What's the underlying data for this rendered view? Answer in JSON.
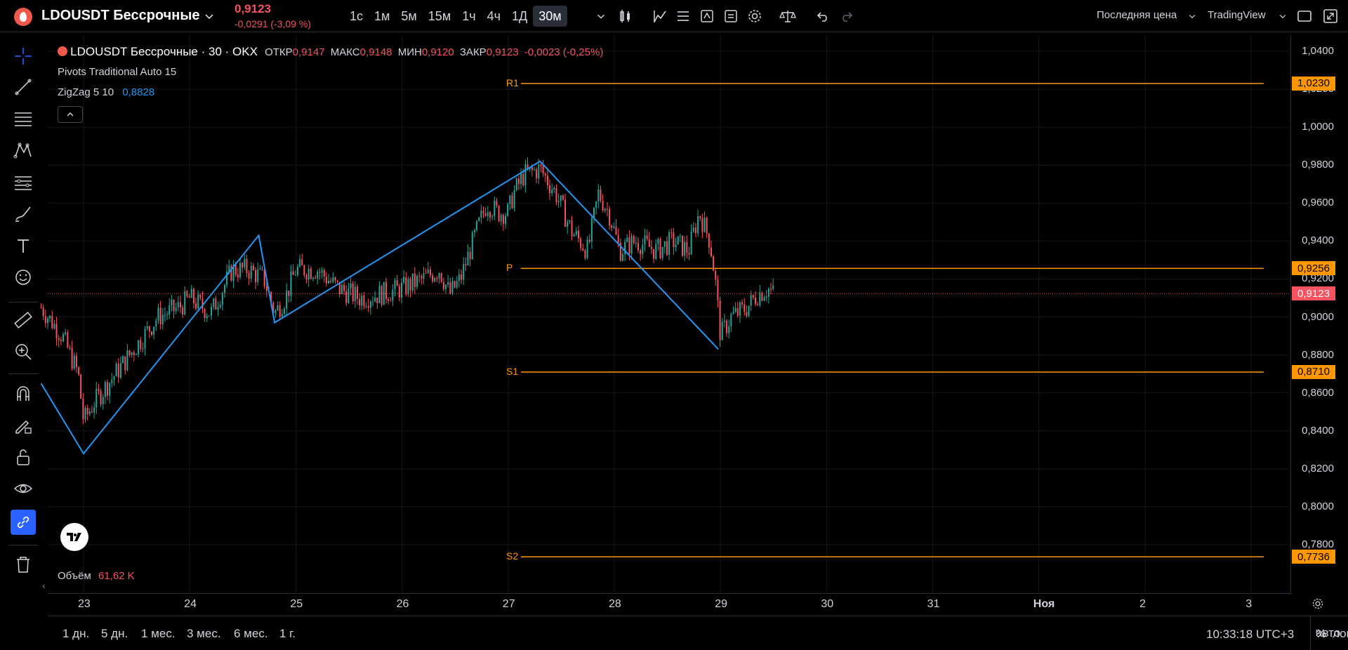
{
  "header": {
    "symbol_title": "LDOUSDT Бессрочные",
    "price": "0,9123",
    "change": "-0,0291 (-3,09 %)",
    "timeframes": [
      "1с",
      "1м",
      "5м",
      "15м",
      "1ч",
      "4ч",
      "1Д",
      "30м"
    ],
    "active_timeframe": "30м",
    "price_type": "Последняя цена",
    "layout_name": "TradingView"
  },
  "legend": {
    "symbol_line": "LDOUSDT Бессрочные · 30 · OKX",
    "open_label": "ОТКР",
    "open_value": "0,9147",
    "high_label": "МАКС",
    "high_value": "0,9148",
    "low_label": "МИН",
    "low_value": "0,9120",
    "close_label": "ЗАКР",
    "close_value": "0,9123",
    "change_value": "-0,0023 (-0,25%)",
    "indicator1": "Pivots Traditional Auto 15",
    "indicator2_name": "ZigZag 5 10",
    "indicator2_value": "0,8828",
    "volume_label": "Объём",
    "volume_value": "61,62 K"
  },
  "pivots": {
    "R1": {
      "label": "R1",
      "value": "1,0230",
      "price": 1.023
    },
    "P": {
      "label": "P",
      "value": "0,9256",
      "price": 0.9256
    },
    "S1": {
      "label": "S1",
      "value": "0,8710",
      "price": 0.871
    },
    "S2": {
      "label": "S2",
      "value": "0,7736",
      "price": 0.7736
    }
  },
  "current_price_tag": "0,9123",
  "price_axis_labels": [
    "1,0400",
    "1,0200",
    "1,0000",
    "0,9800",
    "0,9600",
    "0,9400",
    "0,9200",
    "0,9000",
    "0,8800",
    "0,8600",
    "0,8400",
    "0,8200",
    "0,8000",
    "0,7800"
  ],
  "time_axis_labels": [
    "23",
    "24",
    "25",
    "26",
    "27",
    "28",
    "29",
    "30",
    "31",
    "Ноя",
    "2",
    "3"
  ],
  "ranges": [
    "1 дн.",
    "5 дн.",
    "1 мес.",
    "3 мес.",
    "6 мес.",
    "1 г."
  ],
  "clock": "10:33:18 UTC+3",
  "bottom_right": {
    "percent": "%",
    "log": "лог",
    "auto": "авто"
  },
  "colors": {
    "up": "#26a69a",
    "down": "#f7525f",
    "zigzag": "#2196f3",
    "pivot": "#ff9800"
  },
  "chart_data": {
    "type": "candlestick",
    "title": "LDOUSDT Бессрочные · 30 · OKX",
    "ylim": [
      0.77,
      1.045
    ],
    "zigzag": [
      {
        "x": 22.6,
        "y": 0.865
      },
      {
        "x": 23.0,
        "y": 0.828
      },
      {
        "x": 24.65,
        "y": 0.943
      },
      {
        "x": 24.8,
        "y": 0.897
      },
      {
        "x": 27.3,
        "y": 0.982
      },
      {
        "x": 28.98,
        "y": 0.883
      }
    ],
    "price_path": [
      [
        22.6,
        0.905
      ],
      [
        22.8,
        0.89
      ],
      [
        22.95,
        0.87
      ],
      [
        23.0,
        0.845
      ],
      [
        23.1,
        0.855
      ],
      [
        23.3,
        0.87
      ],
      [
        23.5,
        0.885
      ],
      [
        23.7,
        0.9
      ],
      [
        23.9,
        0.905
      ],
      [
        24.0,
        0.91
      ],
      [
        24.2,
        0.902
      ],
      [
        24.4,
        0.925
      ],
      [
        24.55,
        0.925
      ],
      [
        24.7,
        0.92
      ],
      [
        24.8,
        0.902
      ],
      [
        24.9,
        0.91
      ],
      [
        25.0,
        0.925
      ],
      [
        25.2,
        0.925
      ],
      [
        25.4,
        0.915
      ],
      [
        25.6,
        0.91
      ],
      [
        25.8,
        0.912
      ],
      [
        26.0,
        0.915
      ],
      [
        26.2,
        0.92
      ],
      [
        26.35,
        0.925
      ],
      [
        26.45,
        0.912
      ],
      [
        26.55,
        0.92
      ],
      [
        26.7,
        0.945
      ],
      [
        26.8,
        0.96
      ],
      [
        26.9,
        0.955
      ],
      [
        27.0,
        0.955
      ],
      [
        27.05,
        0.965
      ],
      [
        27.15,
        0.975
      ],
      [
        27.3,
        0.978
      ],
      [
        27.45,
        0.965
      ],
      [
        27.6,
        0.945
      ],
      [
        27.75,
        0.935
      ],
      [
        27.85,
        0.965
      ],
      [
        27.95,
        0.955
      ],
      [
        28.05,
        0.935
      ],
      [
        28.2,
        0.94
      ],
      [
        28.4,
        0.935
      ],
      [
        28.55,
        0.94
      ],
      [
        28.7,
        0.935
      ],
      [
        28.8,
        0.955
      ],
      [
        28.9,
        0.94
      ],
      [
        28.95,
        0.92
      ],
      [
        29.0,
        0.89
      ],
      [
        29.1,
        0.9
      ],
      [
        29.25,
        0.905
      ],
      [
        29.35,
        0.912
      ],
      [
        29.45,
        0.915
      ],
      [
        29.5,
        0.9123
      ]
    ]
  }
}
